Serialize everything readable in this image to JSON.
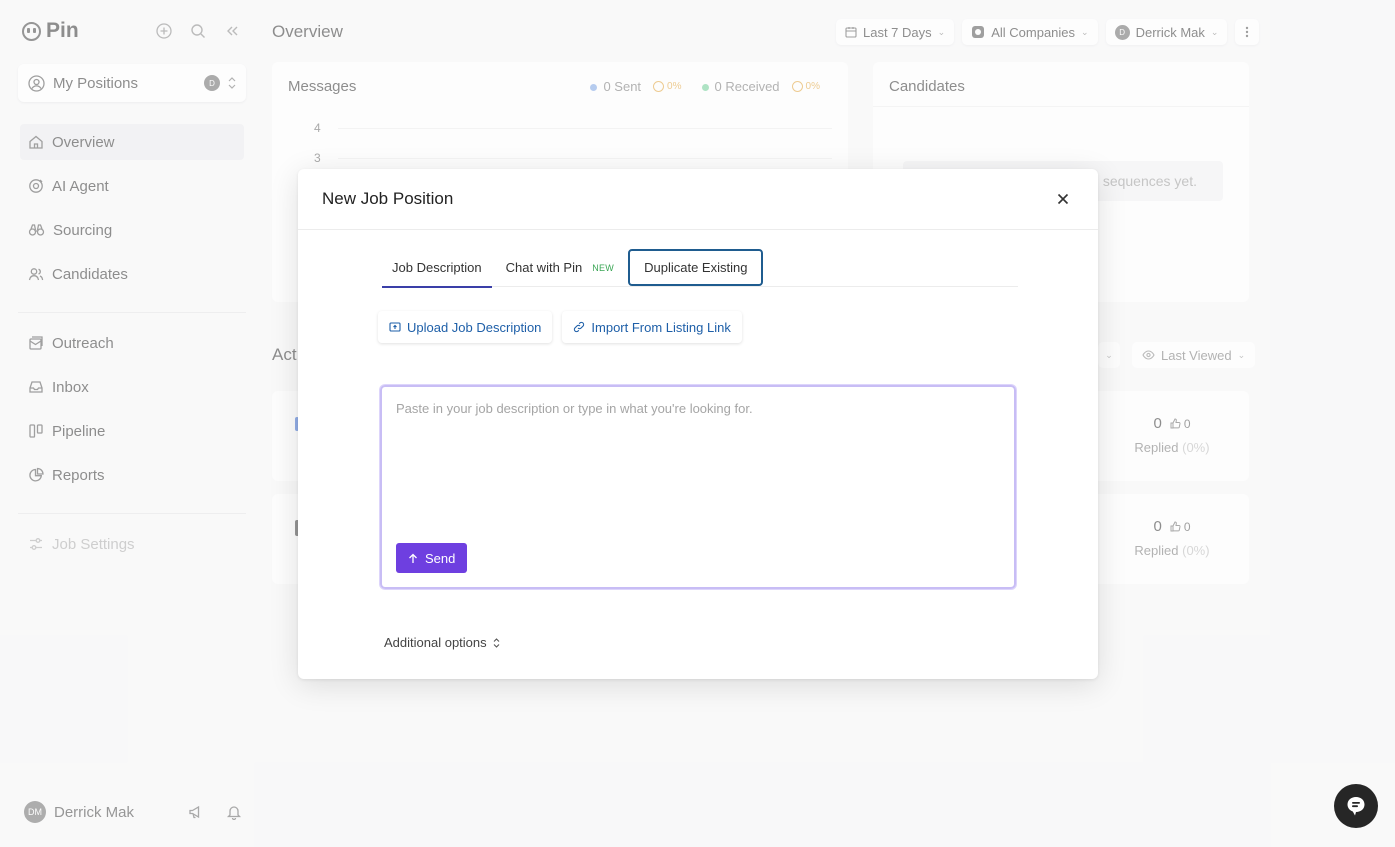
{
  "app": {
    "name": "Pin"
  },
  "sidebar": {
    "position_select": {
      "label": "My Positions",
      "badge": "D"
    },
    "nav_main": [
      {
        "label": "Overview",
        "icon": "home-icon",
        "active": true
      },
      {
        "label": "AI Agent",
        "icon": "ai-agent-icon"
      },
      {
        "label": "Sourcing",
        "icon": "binoculars-icon"
      },
      {
        "label": "Candidates",
        "icon": "users-icon"
      }
    ],
    "nav_secondary": [
      {
        "label": "Outreach",
        "icon": "outreach-icon"
      },
      {
        "label": "Inbox",
        "icon": "inbox-icon"
      },
      {
        "label": "Pipeline",
        "icon": "pipeline-icon"
      },
      {
        "label": "Reports",
        "icon": "pie-chart-icon"
      }
    ],
    "job_settings": "Job Settings",
    "user": {
      "initials": "DM",
      "name": "Derrick Mak"
    }
  },
  "header": {
    "title": "Overview",
    "date_range": "Last 7 Days",
    "company": "All Companies",
    "user": {
      "initial": "D",
      "name": "Derrick Mak"
    }
  },
  "messages": {
    "title": "Messages",
    "sent": "0 Sent",
    "sent_pct": "0%",
    "received": "0 Received",
    "received_pct": "0%",
    "sent_color": "#7fa6e6",
    "received_color": "#6fcf97",
    "y_ticks": [
      "4",
      "3"
    ]
  },
  "candidates": {
    "title": "Candidates",
    "empty_text": "sequences yet."
  },
  "activity": {
    "title": "Act",
    "sort_label": "Last Viewed",
    "rows": [
      {
        "count": "0",
        "likes": "0",
        "label": "Replied",
        "pct": "(0%)"
      },
      {
        "count": "0",
        "likes": "0",
        "label": "Replied",
        "pct": "(0%)"
      }
    ]
  },
  "modal": {
    "title": "New Job Position",
    "tabs": {
      "job_description": "Job Description",
      "chat_with_pin": "Chat with Pin",
      "new_badge": "NEW",
      "duplicate_existing": "Duplicate Existing"
    },
    "upload_label": "Upload Job Description",
    "import_label": "Import From Listing Link",
    "textarea_placeholder": "Paste in your job description or type in what you're looking for.",
    "send_label": "Send",
    "additional_options": "Additional options",
    "accent_color": "#6e3fe0"
  }
}
